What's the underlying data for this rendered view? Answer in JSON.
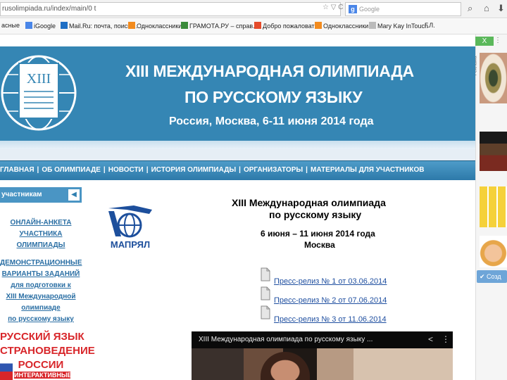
{
  "browser": {
    "url": "rusolimpiada.ru/index/main/0 t",
    "url_icons": "☆ ▽ C",
    "search_placeholder": "Google",
    "search_engine_icon": "g-icon"
  },
  "bookmarks": [
    {
      "label": "асные",
      "color": "#2f5fa8"
    },
    {
      "label": "iGoogle",
      "color": "#4a86e8"
    },
    {
      "label": "Mail.Ru: почта, поиск ...",
      "color": "#1f6fc5"
    },
    {
      "label": "Одноклассники",
      "color": "#f28b1e"
    },
    {
      "label": "ГРАМОТА.РУ – справ...",
      "color": "#3b8b3b"
    },
    {
      "label": "Добро пожаловать",
      "color": "#e54b2b"
    },
    {
      "label": "Одноклассники",
      "color": "#f28b1e"
    },
    {
      "label": "Mary Kay InTouch",
      "color": "#999999"
    },
    {
      "label": "Г.Л.",
      "color": "#777777"
    }
  ],
  "right_strip": {
    "close_label": "X",
    "dots_label": "⋮",
    "vertical_text": "Реклама",
    "button_label": "Созд"
  },
  "banner": {
    "logo_label": "XIII",
    "line1": "XIII МЕЖДУНАРОДНАЯ ОЛИМПИАДА",
    "line2": "ПО РУССКОМУ ЯЗЫКУ",
    "line3": "Россия, Москва, 6-11 июня 2014 года"
  },
  "nav": {
    "items": [
      "ГЛАВНАЯ",
      "ОБ ОЛИМПИАДЕ",
      "НОВОСТИ",
      "ИСТОРИЯ ОЛИМПИАДЫ",
      "ОРГАНИЗАТОРЫ",
      "МАТЕРИАЛЫ ДЛЯ УЧАСТНИКОВ"
    ],
    "separator": "|"
  },
  "sidebar": {
    "heading": "участникам",
    "arrow": "◀",
    "link1": [
      "ОНЛАЙН-АНКЕТА",
      "УЧАСТНИКА",
      "ОЛИМПИАДЫ"
    ],
    "link2": [
      "ДЕМОНСТРАЦИОННЫЕ",
      "ВАРИАНТЫ ЗАДАНИЙ",
      "для подготовки к",
      "XIII Международной",
      "олимпиаде",
      "по русскому языку"
    ],
    "promo": [
      "РУССКИЙ ЯЗЫК",
      "СТРАНОВЕДЕНИЕ",
      "РОССИИ",
      "ИНТЕРАКТИВНЫЕ"
    ]
  },
  "content": {
    "logo_label": "МАПРЯЛ",
    "title1": "XIII Международная олимпиада",
    "title2": "по русскому языку",
    "dates": "6 июня – 11 июня 2014 года",
    "city": "Москва",
    "press_releases": [
      "Пресс-релиз № 1 от 03.06.2014",
      "Пресс-релиз № 2 от 07.06.2014",
      "Пресс-релиз № 3 от 11.06.2014"
    ]
  },
  "video": {
    "title": "XIII Международная олимпиада по русскому языку ...",
    "share_icon": "share-icon",
    "more_icon": "more-icon"
  },
  "colors": {
    "banner": "#3586b4",
    "nav": "#2d79a9",
    "link": "#1f4fa0",
    "promo_red": "#d8262a"
  }
}
